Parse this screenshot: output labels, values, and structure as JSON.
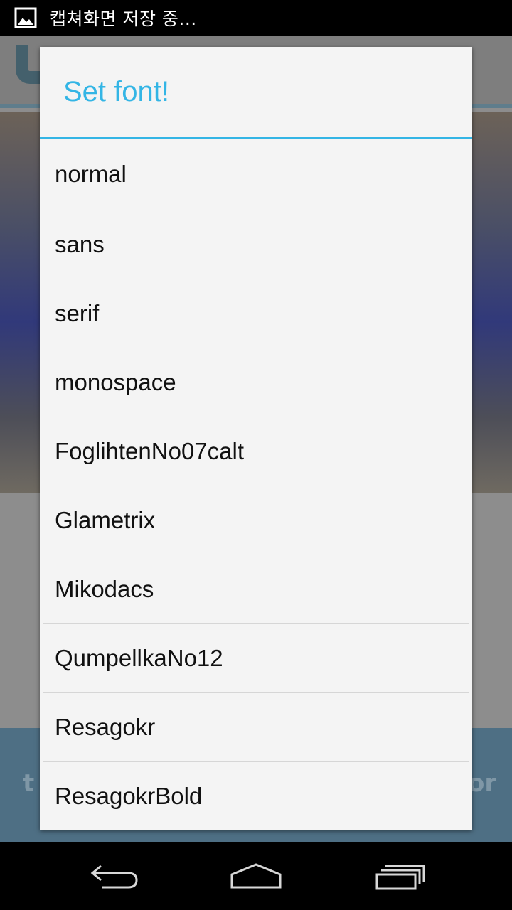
{
  "status_bar": {
    "notification_icon": "image-icon",
    "text": "캡쳐화면 저장 중..."
  },
  "dialog": {
    "title": "Set font!",
    "fonts": [
      "normal",
      "sans",
      "serif",
      "monospace",
      "FoglihtenNo07calt",
      "Glametrix",
      "Mikodacs",
      "QumpellkaNo12",
      "Resagokr",
      "ResagokrBold"
    ]
  },
  "nav_bar": {
    "back": "back-icon",
    "home": "home-icon",
    "recents": "recent-apps-icon"
  },
  "colors": {
    "accent": "#33b5e5",
    "dialog_bg": "#f4f4f4",
    "dim_bg": "#8d8d8d"
  }
}
